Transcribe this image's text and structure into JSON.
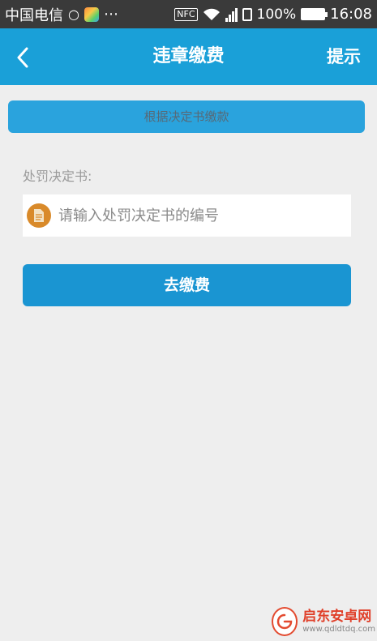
{
  "status_bar": {
    "carrier": "中国电信",
    "nfc_label": "NFC",
    "battery_level": "100%",
    "time": "16:08",
    "icons": [
      "weibo-icon",
      "app-icon",
      "more-dots-icon",
      "nfc-icon",
      "wifi-icon",
      "signal-icon",
      "sim-icon",
      "battery-icon"
    ]
  },
  "header": {
    "back_icon": "back-chevron-icon",
    "title": "违章缴费",
    "tip_label": "提示",
    "background_color": "#1aa0d8"
  },
  "mode_banner": {
    "label": "根据决定书缴款"
  },
  "form": {
    "field_label": "处罚决定书:",
    "input_icon": "document-icon",
    "input_placeholder": "请输入处罚决定书的编号",
    "input_value": ""
  },
  "actions": {
    "pay_label": "去缴费",
    "pay_color": "#1a95d2"
  },
  "watermark": {
    "title": "启东安卓网",
    "url": "www.qdldtdq.com"
  }
}
